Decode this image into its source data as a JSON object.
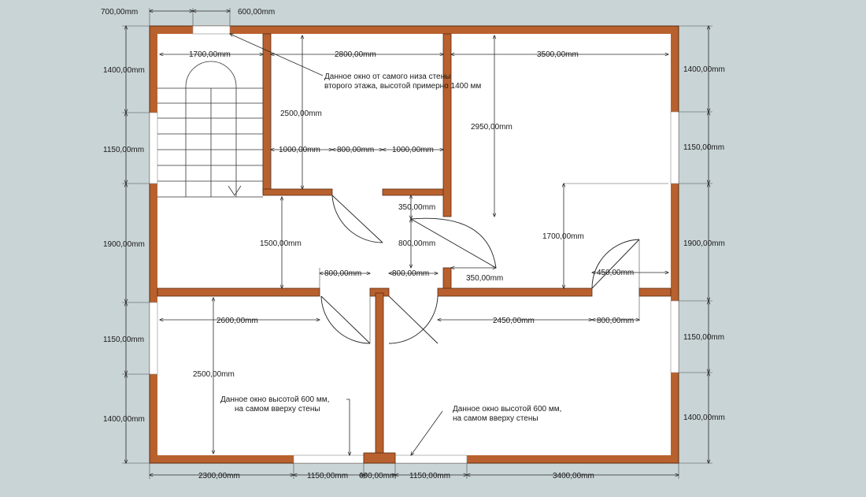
{
  "dimensions": {
    "top_700": "700,00mm",
    "top_600": "600,00mm",
    "stair_width": "1700,00mm",
    "room_nw_width": "2800,00mm",
    "room_ne_width": "3500,00mm",
    "room_nw_height": "2500,00mm",
    "room_ne_height": "2950,00mm",
    "seg_1000_a": "1000,00mm",
    "seg_800_door": "800,00mm",
    "seg_1000_b": "1000,00mm",
    "seg_350_a": "350,00mm",
    "corridor_door": "800,00mm",
    "seg_350_b": "350,00mm",
    "hall_height": "1500,00mm",
    "ne_lower_height": "1700,00mm",
    "door_800_a": "800,00mm",
    "door_800_b": "800,00mm",
    "door_450": "450,00mm",
    "room_sw_width": "2600,00mm",
    "room_se_width": "2450,00mm",
    "room_se_door": "800,00mm",
    "room_sw_height": "2500,00mm",
    "left_1400_top": "1400,00mm",
    "left_1150_a": "1150,00mm",
    "left_1900": "1900,00mm",
    "left_1150_b": "1150,00mm",
    "left_1400_bottom": "1400,00mm",
    "right_1400_top": "1400,00mm",
    "right_1150_a": "1150,00mm",
    "right_1900": "1900,00mm",
    "right_1150_b": "1150,00mm",
    "right_1400_bottom": "1400,00mm",
    "bottom_2300": "2300,00mm",
    "bottom_1150_a": "1150,00mm",
    "bottom_600": "600,00mm",
    "bottom_1150_b": "1150,00mm",
    "bottom_3400": "3400,00mm"
  },
  "notes": {
    "top_window_line1": "Данное окно от самого низа стены",
    "top_window_line2": "второго этажа, высотой примерно 1400 мм",
    "sw_window_line1": "Данное окно высотой 600 мм,",
    "sw_window_line2": "на самом вверху стены",
    "se_window_line1": "Данное окно высотой 600 мм,",
    "se_window_line2": "на самом вверху стены"
  }
}
